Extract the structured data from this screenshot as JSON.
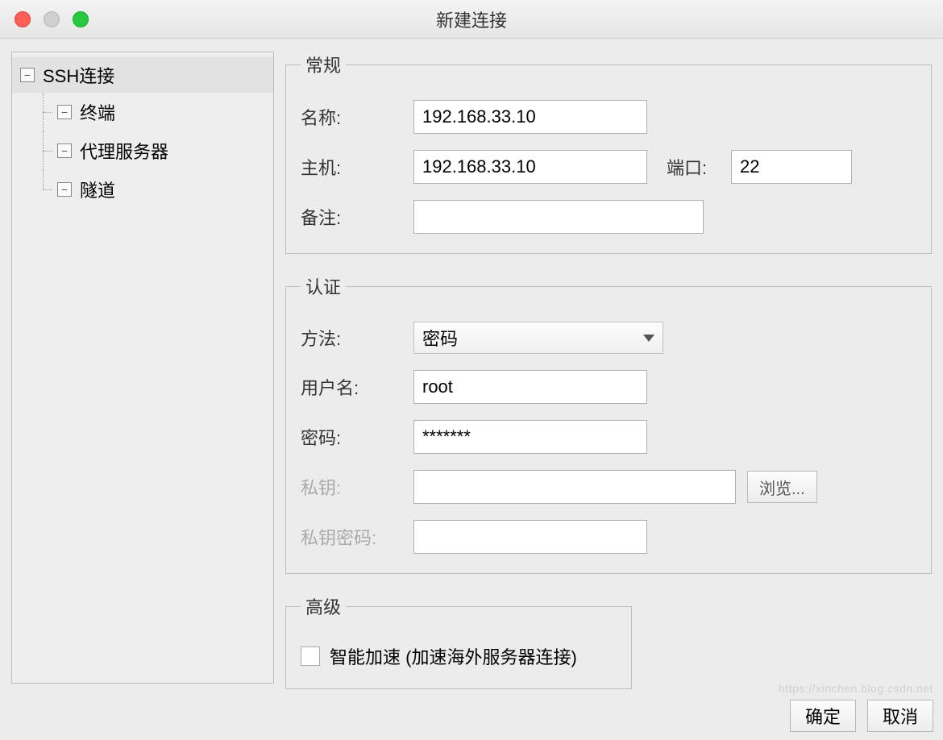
{
  "window": {
    "title": "新建连接"
  },
  "sidebar": {
    "root": "SSH连接",
    "items": [
      "终端",
      "代理服务器",
      "隧道"
    ]
  },
  "general": {
    "legend": "常规",
    "name_label": "名称:",
    "name_value": "192.168.33.10",
    "host_label": "主机:",
    "host_value": "192.168.33.10",
    "port_label": "端口:",
    "port_value": "22",
    "remark_label": "备注:",
    "remark_value": ""
  },
  "auth": {
    "legend": "认证",
    "method_label": "方法:",
    "method_value": "密码",
    "user_label": "用户名:",
    "user_value": "root",
    "pass_label": "密码:",
    "pass_value": "*******",
    "pk_label": "私钥:",
    "pk_value": "",
    "browse_label": "浏览...",
    "pkpass_label": "私钥密码:",
    "pkpass_value": ""
  },
  "advanced": {
    "legend": "高级",
    "smart_accel_label": "智能加速 (加速海外服务器连接)",
    "smart_accel_checked": false
  },
  "buttons": {
    "ok": "确定",
    "cancel": "取消"
  },
  "watermark": "https://xinchen.blog.csdn.net"
}
